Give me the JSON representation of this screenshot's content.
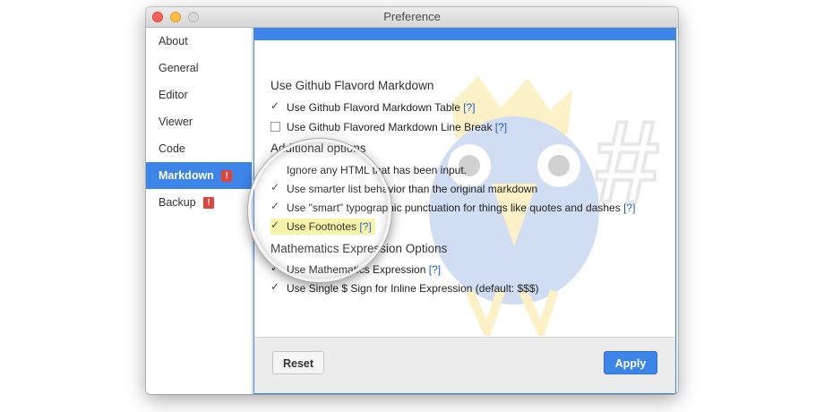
{
  "window": {
    "title": "Preference"
  },
  "sidebar": {
    "items": [
      {
        "label": "About",
        "badge": ""
      },
      {
        "label": "General",
        "badge": ""
      },
      {
        "label": "Editor",
        "badge": ""
      },
      {
        "label": "Viewer",
        "badge": ""
      },
      {
        "label": "Code",
        "badge": ""
      },
      {
        "label": "Markdown",
        "badge": "!",
        "active": true
      },
      {
        "label": "Backup",
        "badge": "!"
      }
    ]
  },
  "sections": {
    "github": {
      "title": "Use Github Flavord Markdown",
      "options": [
        {
          "label": "Use Github Flavord Markdown Table",
          "help": "[?]",
          "checked": true
        },
        {
          "label": "Use Github Flavored Markdown Line Break",
          "help": "[?]",
          "checked": false
        }
      ]
    },
    "additional": {
      "title": "Additional options",
      "options": [
        {
          "label": "Ignore any HTML that has been input.",
          "help": "",
          "checked": false
        },
        {
          "label": "Use smarter list behavior than the original markdown",
          "help": "",
          "checked": true
        },
        {
          "label": "Use \"smart\" typographic punctuation for things like quotes and dashes",
          "help": "[?]",
          "checked": true
        },
        {
          "label": "Use Footnotes",
          "help": "[?]",
          "checked": true,
          "highlighted": true
        }
      ]
    },
    "math": {
      "title": "Mathematics Expression Options",
      "options": [
        {
          "label": "Use Mathematics Expression",
          "help": "[?]",
          "checked": true
        },
        {
          "label": "Use Single $ Sign for Inline Expression (default: $$$)",
          "help": "",
          "checked": true
        }
      ]
    }
  },
  "footer": {
    "reset_label": "Reset",
    "apply_label": "Apply"
  },
  "colors": {
    "accent": "#3c84e8",
    "badge": "#e0443a",
    "highlight": "#f7f3a3"
  }
}
